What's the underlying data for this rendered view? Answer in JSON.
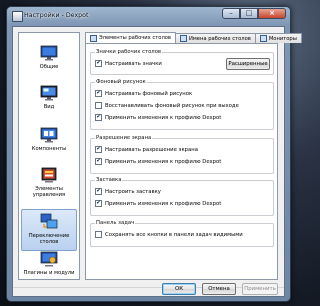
{
  "window": {
    "title": "Настройки - Dexpot"
  },
  "sidebar": {
    "items": [
      {
        "label": "Общие",
        "icon": "monitor-icon"
      },
      {
        "label": "Вид",
        "icon": "display-icon"
      },
      {
        "label": "Компоненты",
        "icon": "components-icon"
      },
      {
        "label": "Элементы управления",
        "icon": "controls-icon"
      },
      {
        "label": "Переключение столов",
        "icon": "desktop-switch-icon",
        "selected": true
      },
      {
        "label": "Плагины и модули",
        "icon": "plugins-icon"
      }
    ]
  },
  "tabs": [
    {
      "label": "Элементы рабочих столов",
      "active": true
    },
    {
      "label": "Имена рабочих столов",
      "active": false
    },
    {
      "label": "Мониторы",
      "active": false
    }
  ],
  "groups": {
    "icons": {
      "title": "Значки рабочих столов",
      "checkbox": {
        "label": "Настраивать значки",
        "checked": true
      },
      "button": "Расширенные"
    },
    "wallpaper": {
      "title": "Фоновый рисунок",
      "checkboxes": [
        {
          "label": "Настраивать фоновый рисунок",
          "checked": true
        },
        {
          "label": "Восстанавливать фоновый рисунок при выходе",
          "checked": false
        },
        {
          "label": "Применить изменения к профилю Dexpot",
          "checked": true
        }
      ]
    },
    "resolution": {
      "title": "Разрешение экрана",
      "checkboxes": [
        {
          "label": "Настраивать разрешение экрана",
          "checked": true
        },
        {
          "label": "Применить изменения к профилю Dexpot",
          "checked": true
        }
      ]
    },
    "screensaver": {
      "title": "Заставка",
      "checkboxes": [
        {
          "label": "Настроить заставку",
          "checked": true
        },
        {
          "label": "Применить изменения к профилю Dexpot",
          "checked": true
        }
      ]
    },
    "taskbar": {
      "title": "Панель задач",
      "checkboxes": [
        {
          "label": "Сохранять все кнопки в панели задач видимыми",
          "checked": false
        }
      ]
    }
  },
  "footer": {
    "ok": "ОК",
    "cancel": "Отмена",
    "apply": "Применить"
  },
  "checkmark": "✔",
  "colors": {
    "accent": "#3c7fb1",
    "title_bar": "#8ea7c4",
    "selected_item": "#c9dcf3"
  }
}
